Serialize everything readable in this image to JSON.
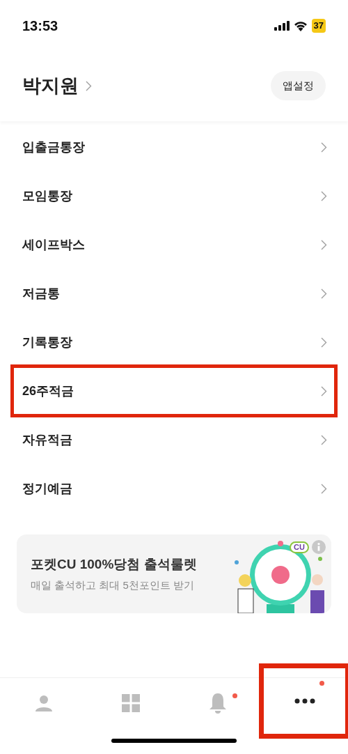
{
  "status_bar": {
    "time": "13:53",
    "battery": "37"
  },
  "header": {
    "name": "박지원",
    "settings_button": "앱설정"
  },
  "menu": [
    {
      "label": "입출금통장",
      "highlighted": false
    },
    {
      "label": "모임통장",
      "highlighted": false
    },
    {
      "label": "세이프박스",
      "highlighted": false
    },
    {
      "label": "저금통",
      "highlighted": false
    },
    {
      "label": "기록통장",
      "highlighted": false
    },
    {
      "label": "26주적금",
      "highlighted": true
    },
    {
      "label": "자유적금",
      "highlighted": false
    },
    {
      "label": "정기예금",
      "highlighted": false
    }
  ],
  "banner": {
    "title": "포켓CU 100%당첨 출석룰렛",
    "subtitle": "매일 출석하고 최대 5천포인트 받기",
    "logo": "CU",
    "kind": "picture"
  },
  "tab_bar": [
    {
      "kind": "person",
      "selected": false,
      "badge": false,
      "highlighted": false
    },
    {
      "kind": "grid",
      "selected": false,
      "badge": false,
      "highlighted": false
    },
    {
      "kind": "bell",
      "selected": false,
      "badge": true,
      "highlighted": false
    },
    {
      "kind": "more",
      "selected": true,
      "badge": true,
      "highlighted": true
    }
  ]
}
